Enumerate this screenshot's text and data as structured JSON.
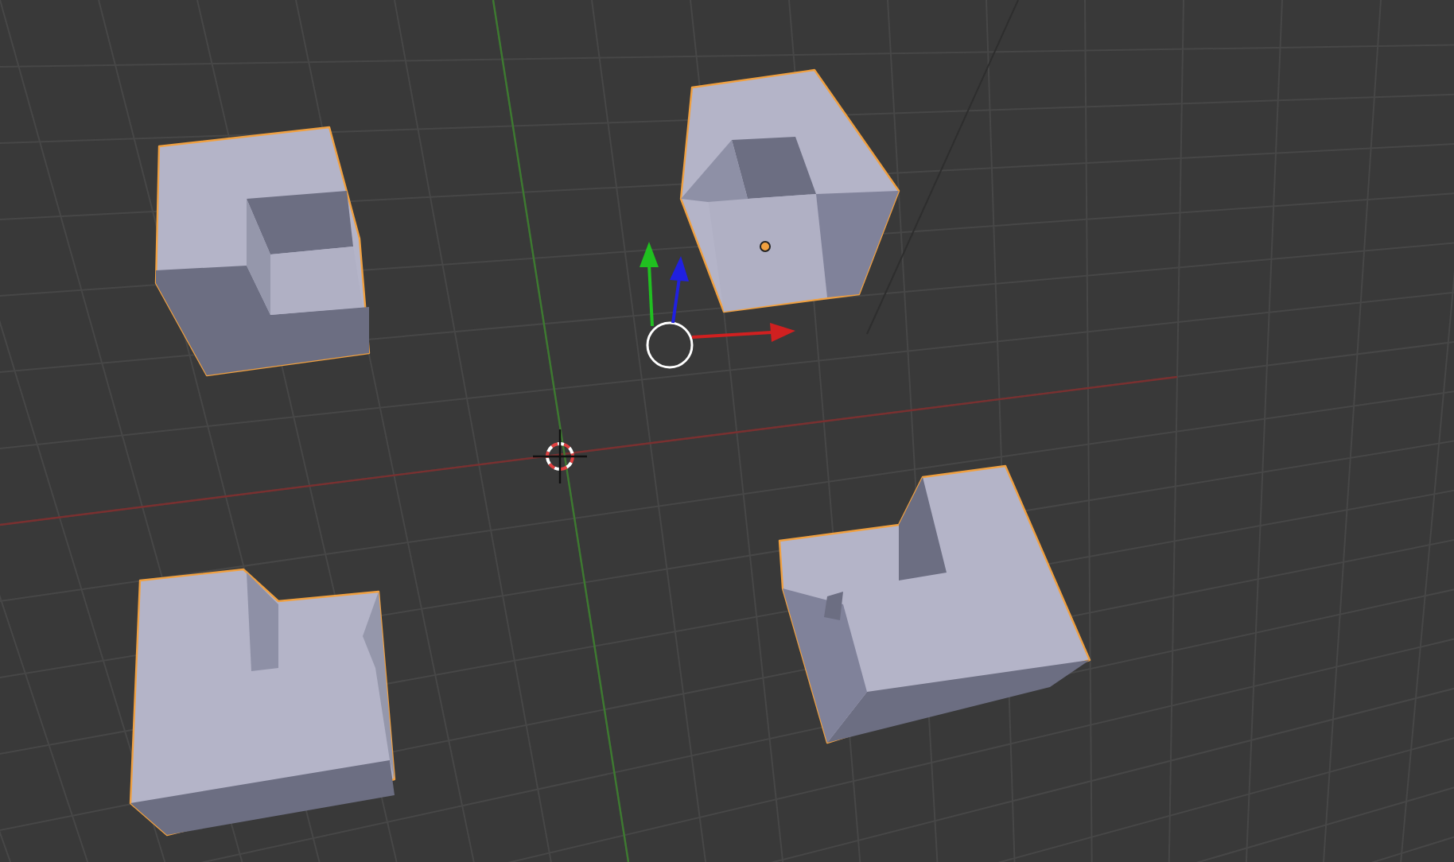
{
  "viewport": {
    "objects": [
      {
        "kind": "notched-cube",
        "selected": true,
        "active": false
      },
      {
        "kind": "notched-cube",
        "selected": true,
        "active": true
      },
      {
        "kind": "notched-cube",
        "selected": true,
        "active": false
      },
      {
        "kind": "notched-cube",
        "selected": true,
        "active": false
      }
    ]
  }
}
